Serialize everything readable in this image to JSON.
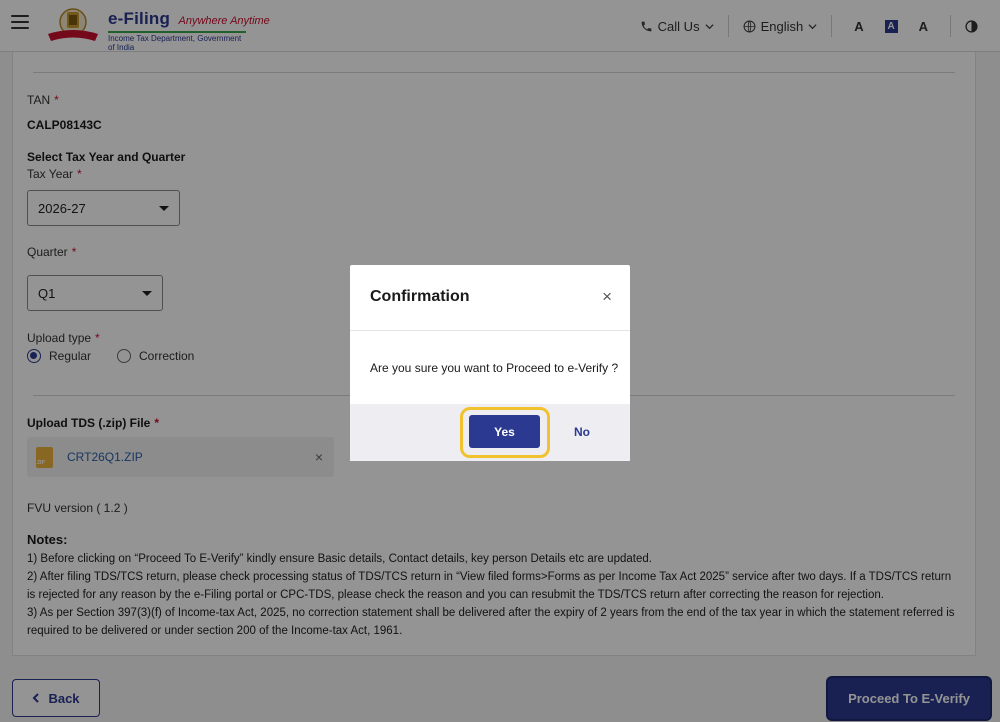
{
  "header": {
    "brand_title": "e-Filing",
    "brand_tagline": "Anywhere Anytime",
    "brand_subtitle": "Income Tax Department, Government of India",
    "call_us": "Call Us",
    "language": "English",
    "font_decrease": "A",
    "font_normal": "A",
    "font_increase": "A"
  },
  "form": {
    "tan_label": "TAN",
    "tan_value": "CALP08143C",
    "select_section_title": "Select Tax Year and Quarter",
    "tax_year_label": "Tax Year",
    "tax_year_value": "2026-27",
    "quarter_label": "Quarter",
    "quarter_value": "Q1",
    "upload_type_label": "Upload type",
    "upload_type_options": [
      "Regular",
      "Correction"
    ],
    "upload_type_selected": "Regular",
    "upload_file_label": "Upload TDS (.zip) File",
    "file_name": "CRT26Q1.ZIP",
    "fvu_version": "FVU version ( 1.2 )",
    "required_mark": "*"
  },
  "notes": {
    "title": "Notes:",
    "items": [
      "1) Before clicking on “Proceed To E-Verify” kindly ensure Basic details, Contact details, key person Details etc are updated.",
      "2) After filing TDS/TCS return, please check processing status of TDS/TCS return in “View filed forms>Forms as per Income Tax Act 2025” service after two days. If a TDS/TCS return is rejected for any reason by the e-Filing portal or CPC-TDS, please check the reason and you can resubmit the TDS/TCS return after correcting the reason for rejection.",
      "3) As per Section 397(3)(f) of Income-tax Act, 2025, no correction statement shall be delivered after the expiry of 2 years from the end of the tax year in which the statement referred is required to be delivered or under section 200 of the Income-tax Act, 1961."
    ]
  },
  "actions": {
    "back_label": "Back",
    "proceed_label": "Proceed To E-Verify"
  },
  "dialog": {
    "title": "Confirmation",
    "message": "Are you sure you want to Proceed to e-Verify ?",
    "yes_label": "Yes",
    "no_label": "No",
    "close_glyph": "×"
  },
  "colors": {
    "primary": "#2b3990",
    "highlight": "#f2c12e",
    "required": "#c8102e",
    "overlay": "rgba(0,0,0,0.42)"
  }
}
